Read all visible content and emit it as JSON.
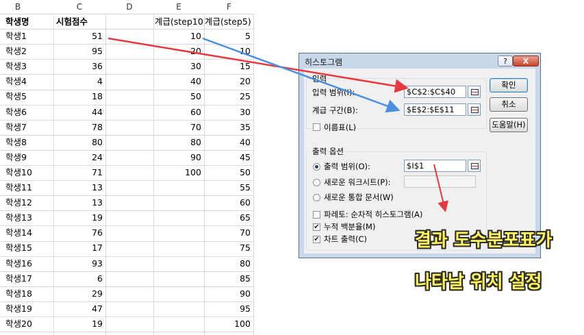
{
  "sheet": {
    "columns": [
      "B",
      "C",
      "D",
      "E",
      "F"
    ],
    "headers": {
      "b": "학생명",
      "c": "시험점수",
      "e": "계급(step10",
      "f": "계급(step5)"
    },
    "rows": [
      {
        "b": "학생1",
        "c": "51",
        "e": "10",
        "f": "5"
      },
      {
        "b": "학생2",
        "c": "95",
        "e": "20",
        "f": "10"
      },
      {
        "b": "학생3",
        "c": "36",
        "e": "30",
        "f": "15"
      },
      {
        "b": "학생4",
        "c": "4",
        "e": "40",
        "f": "20"
      },
      {
        "b": "학생5",
        "c": "18",
        "e": "50",
        "f": "25"
      },
      {
        "b": "학생6",
        "c": "44",
        "e": "60",
        "f": "30"
      },
      {
        "b": "학생7",
        "c": "78",
        "e": "70",
        "f": "35"
      },
      {
        "b": "학생8",
        "c": "80",
        "e": "80",
        "f": "40"
      },
      {
        "b": "학생9",
        "c": "24",
        "e": "90",
        "f": "45"
      },
      {
        "b": "학생10",
        "c": "71",
        "e": "100",
        "f": "50"
      },
      {
        "b": "학생11",
        "c": "13",
        "e": "",
        "f": "55"
      },
      {
        "b": "학생12",
        "c": "13",
        "e": "",
        "f": "60"
      },
      {
        "b": "학생13",
        "c": "19",
        "e": "",
        "f": "65"
      },
      {
        "b": "학생14",
        "c": "76",
        "e": "",
        "f": "70"
      },
      {
        "b": "학생15",
        "c": "17",
        "e": "",
        "f": "75"
      },
      {
        "b": "학생16",
        "c": "93",
        "e": "",
        "f": "80"
      },
      {
        "b": "학생17",
        "c": "6",
        "e": "",
        "f": "85"
      },
      {
        "b": "학생18",
        "c": "29",
        "e": "",
        "f": "90"
      },
      {
        "b": "학생19",
        "c": "47",
        "e": "",
        "f": "95"
      },
      {
        "b": "학생20",
        "c": "19",
        "e": "",
        "f": "100"
      }
    ]
  },
  "dialog": {
    "title": "히스토그램",
    "help_button": "?",
    "close_button": "X",
    "input_group": "입력",
    "input_range_label": "입력 범위(I):",
    "input_range_value": "$C$2:$C$40",
    "bin_range_label": "계급 구간(B):",
    "bin_range_value": "$E$2:$E$11",
    "labels_checkbox": "이름표(L)",
    "output_group": "출력 옵션",
    "output_range_label": "출력 범위(O):",
    "output_range_value": "$I$1",
    "new_worksheet_label": "새로운 워크시트(P):",
    "new_workbook_label": "새로운 통합 문서(W)",
    "pareto_label": "파레토: 순차적 히스토그램(A)",
    "cumulative_label": "누적 백분율(M)",
    "chart_output_label": "차트 출력(C)",
    "ok_button": "확인",
    "cancel_button": "취소",
    "help_text_button": "도움말(H)",
    "checked": {
      "labels": false,
      "pareto": false,
      "cumulative": true,
      "chart": true
    }
  },
  "annotation": {
    "line1": "결과 도수분포표가",
    "line2": "나타날 위치 설정"
  },
  "colors": {
    "arrow_red": "#e8383d",
    "arrow_blue": "#4a8fe0",
    "annotation_text": "#fff45a"
  }
}
